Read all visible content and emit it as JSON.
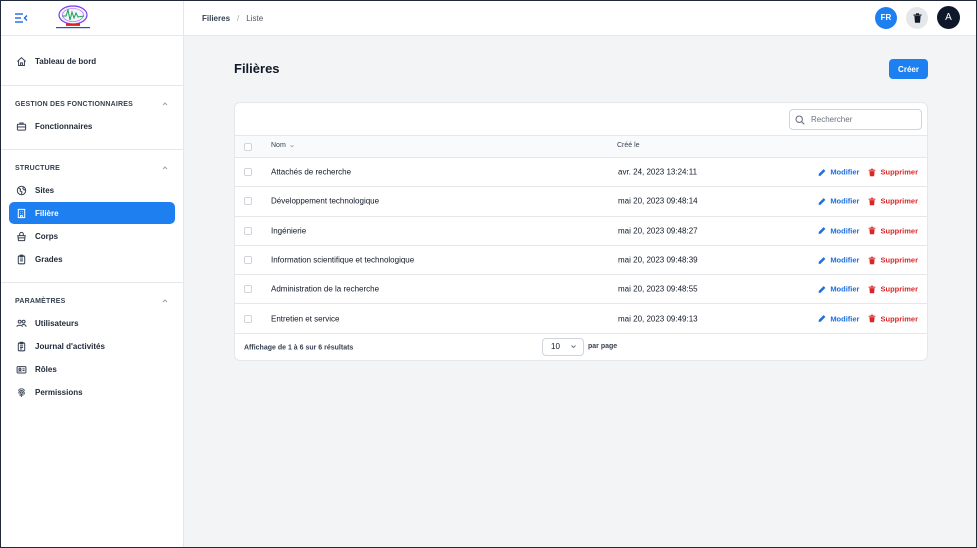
{
  "breadcrumb": {
    "section": "Filieres",
    "page": "Liste"
  },
  "topbar": {
    "lang": "FR",
    "avatar_initial": "A"
  },
  "sidebar": {
    "dashboard": {
      "label": "Tableau de bord",
      "icon": "home-icon"
    },
    "groups": [
      {
        "title": "GESTION DES FONCTIONNAIRES",
        "items": [
          {
            "label": "Fonctionnaires",
            "icon": "briefcase-icon"
          }
        ]
      },
      {
        "title": "STRUCTURE",
        "items": [
          {
            "label": "Sites",
            "icon": "globe-icon"
          },
          {
            "label": "Filière",
            "icon": "building-icon",
            "active": true
          },
          {
            "label": "Corps",
            "icon": "bag-icon"
          },
          {
            "label": "Grades",
            "icon": "clipboard-icon"
          }
        ]
      },
      {
        "title": "PARAMÈTRES",
        "items": [
          {
            "label": "Utilisateurs",
            "icon": "users-icon"
          },
          {
            "label": "Journal d'activités",
            "icon": "clipboard-list-icon"
          },
          {
            "label": "Rôles",
            "icon": "id-card-icon"
          },
          {
            "label": "Permissions",
            "icon": "fingerprint-icon"
          }
        ]
      }
    ]
  },
  "main": {
    "title": "Filières",
    "create_label": "Créer",
    "search_placeholder": "Rechercher",
    "columns": {
      "name": "Nom",
      "created": "Créé le"
    },
    "rows": [
      {
        "name": "Attachés de recherche",
        "created": "avr. 24, 2023 13:24:11"
      },
      {
        "name": "Développement technologique",
        "created": "mai 20, 2023 09:48:14"
      },
      {
        "name": "Ingénierie",
        "created": "mai 20, 2023 09:48:27"
      },
      {
        "name": "Information scientifique et technologique",
        "created": "mai 20, 2023 09:48:39"
      },
      {
        "name": "Administration de la recherche",
        "created": "mai 20, 2023 09:48:55"
      },
      {
        "name": "Entretien et service",
        "created": "mai 20, 2023 09:49:13"
      }
    ],
    "actions": {
      "edit": "Modifier",
      "delete": "Supprimer"
    },
    "footer": {
      "summary": "Affichage de 1 à 6 sur 6 résultats",
      "per_page_value": "10",
      "per_page_label": "par page"
    }
  },
  "colors": {
    "primary": "#1e80f0",
    "danger": "#dc2626",
    "background": "#f3f4f6"
  }
}
